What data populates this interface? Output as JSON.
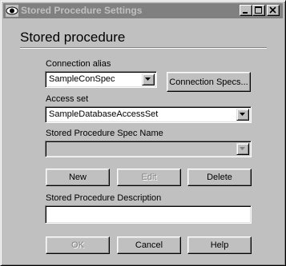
{
  "window": {
    "title": "Stored Procedure Settings"
  },
  "heading": "Stored procedure",
  "connection_alias": {
    "label": "Connection alias",
    "value": "SampleConSpec"
  },
  "connection_specs_button": "Connection Specs...",
  "access_set": {
    "label": "Access set",
    "value": "SampleDatabaseAccessSet"
  },
  "spec_name": {
    "label": "Stored Procedure Spec Name",
    "value": ""
  },
  "actions": {
    "new": "New",
    "edit": "Edit",
    "delete": "Delete"
  },
  "description": {
    "label": "Stored Procedure Description",
    "value": ""
  },
  "footer": {
    "ok": "OK",
    "cancel": "Cancel",
    "help": "Help"
  }
}
